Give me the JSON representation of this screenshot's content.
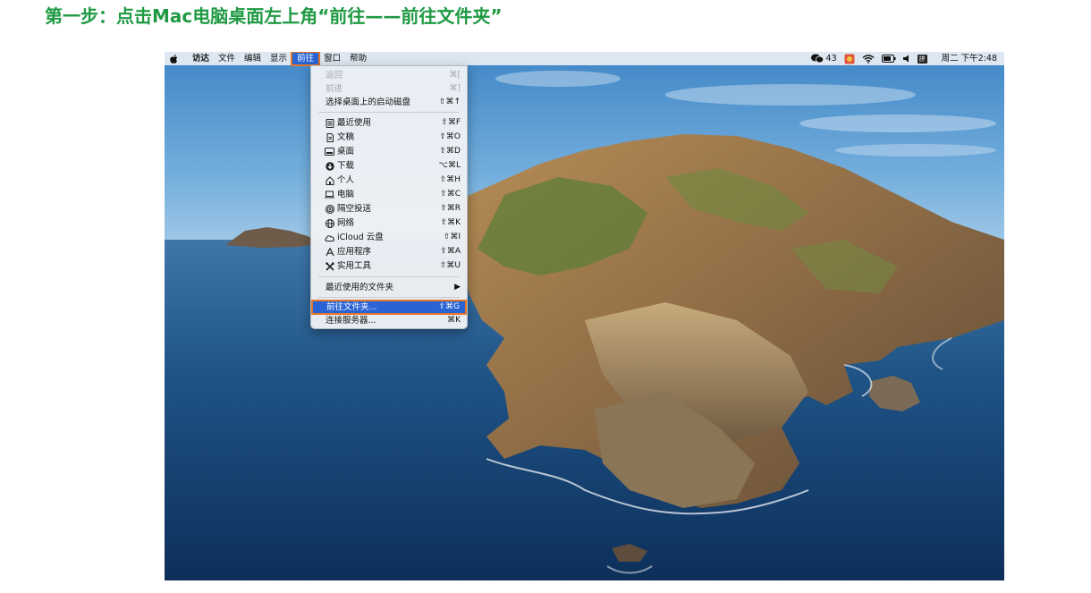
{
  "page": {
    "title": "第一步：点击Mac电脑桌面左上角“前往——前往文件夹”"
  },
  "menubar": {
    "apple_icon": "apple-logo-icon",
    "items": [
      "访达",
      "文件",
      "编辑",
      "显示",
      "前往",
      "窗口",
      "帮助"
    ],
    "active_item": "前往",
    "status": {
      "wechat_badge": "43",
      "ime_label": "拼",
      "clock": "周二 下午2:48"
    }
  },
  "go_menu": {
    "items": [
      {
        "label": "返回",
        "shortcut": "⌘[",
        "disabled": true
      },
      {
        "label": "前进",
        "shortcut": "⌘]",
        "disabled": true
      },
      {
        "label": "选择桌面上的启动磁盘",
        "shortcut": "⇧⌘↑"
      },
      {
        "label": "最近使用",
        "shortcut": "⇧⌘F",
        "icon": "recents-icon"
      },
      {
        "label": "文稿",
        "shortcut": "⇧⌘O",
        "icon": "documents-icon"
      },
      {
        "label": "桌面",
        "shortcut": "⇧⌘D",
        "icon": "desktop-icon"
      },
      {
        "label": "下载",
        "shortcut": "⌥⌘L",
        "icon": "downloads-icon"
      },
      {
        "label": "个人",
        "shortcut": "⇧⌘H",
        "icon": "home-icon"
      },
      {
        "label": "电脑",
        "shortcut": "⇧⌘C",
        "icon": "computer-icon"
      },
      {
        "label": "隔空投送",
        "shortcut": "⇧⌘R",
        "icon": "airdrop-icon"
      },
      {
        "label": "网络",
        "shortcut": "⇧⌘K",
        "icon": "network-icon"
      },
      {
        "label": "iCloud 云盘",
        "shortcut": "⇧⌘I",
        "icon": "icloud-icon"
      },
      {
        "label": "应用程序",
        "shortcut": "⇧⌘A",
        "icon": "applications-icon"
      },
      {
        "label": "实用工具",
        "shortcut": "⇧⌘U",
        "icon": "utilities-icon"
      },
      {
        "label": "最近使用的文件夹",
        "shortcut": "▶"
      },
      {
        "label": "前往文件夹...",
        "shortcut": "⇧⌘G",
        "highlighted": true
      },
      {
        "label": "连接服务器...",
        "shortcut": "⌘K"
      }
    ]
  },
  "colors": {
    "title_green": "#1f9a43",
    "highlight_orange": "#e2762a",
    "selection_blue": "#2a63d4"
  }
}
